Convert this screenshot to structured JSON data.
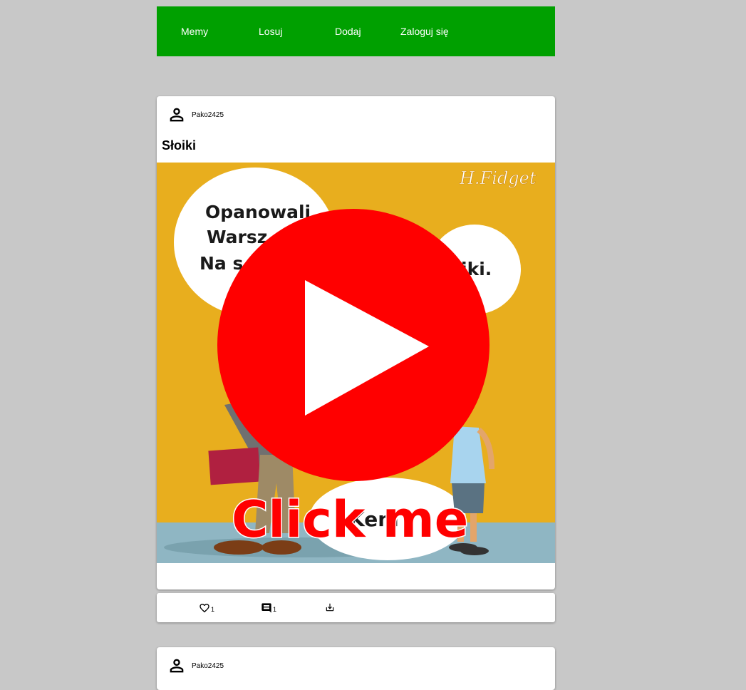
{
  "nav": {
    "items": [
      {
        "label": "Memy"
      },
      {
        "label": "Losuj"
      },
      {
        "label": "Dodaj"
      },
      {
        "label": "Zaloguj się"
      }
    ]
  },
  "post1": {
    "author": "Pako2425",
    "title": "Słoiki",
    "image": {
      "bubble_top": [
        "Opanowali",
        "Warsz",
        "Na s"
      ],
      "bubble_right": "iki.",
      "bubble_bottom": "Keni",
      "signature": "H.Fidget",
      "overlay_caption": "Click me"
    },
    "likes": "1",
    "comments": "1"
  },
  "post2": {
    "author": "Pako2425"
  },
  "colors": {
    "nav_bg": "#00a000",
    "page_bg": "#c8c8c8",
    "play_red": "#ff0000",
    "image_bg": "#e8ae1e"
  },
  "icons": [
    "person-icon",
    "heart-icon",
    "comment-icon",
    "download-icon",
    "play-icon"
  ]
}
